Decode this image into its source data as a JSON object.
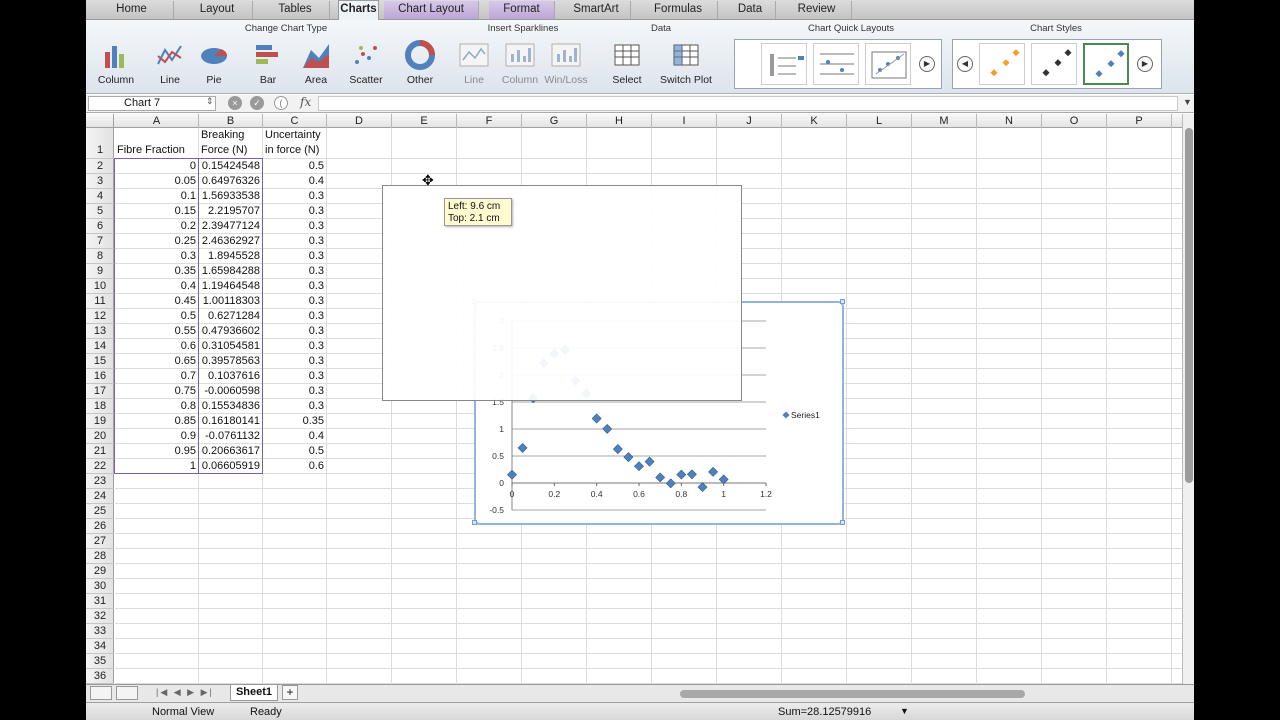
{
  "tabs": [
    {
      "label": "Home",
      "style": "normal"
    },
    {
      "label": "Layout",
      "style": "normal"
    },
    {
      "label": "Tables",
      "style": "normal"
    },
    {
      "label": "Charts",
      "style": "active"
    },
    {
      "label": "Chart Layout",
      "style": "purple"
    },
    {
      "label": "Format",
      "style": "purple"
    },
    {
      "label": "SmartArt",
      "style": "normal"
    },
    {
      "label": "Formulas",
      "style": "normal"
    },
    {
      "label": "Data",
      "style": "normal"
    },
    {
      "label": "Review",
      "style": "normal"
    }
  ],
  "ribbon": {
    "group_chart_type": "Change Chart Type",
    "group_sparklines": "Insert Sparklines",
    "group_data": "Data",
    "group_quick_layouts": "Chart Quick Layouts",
    "group_styles": "Chart Styles",
    "chart_types": [
      "Column",
      "Line",
      "Pie",
      "Bar",
      "Area",
      "Scatter",
      "Other"
    ],
    "sparklines": [
      "Line",
      "Column",
      "Win/Loss"
    ],
    "data_buttons": [
      "Select",
      "Switch Plot"
    ]
  },
  "formula_bar": {
    "name_box": "Chart 7",
    "fx": "fx",
    "value": ""
  },
  "columns": [
    "A",
    "B",
    "C",
    "D",
    "E",
    "F",
    "G",
    "H",
    "I",
    "J",
    "K",
    "L",
    "M",
    "N",
    "O",
    "P"
  ],
  "rows": [
    "1",
    "2",
    "3",
    "4",
    "5",
    "6",
    "7",
    "8",
    "9",
    "10",
    "11",
    "12",
    "13",
    "14",
    "15",
    "16",
    "17",
    "18",
    "19",
    "20",
    "21",
    "22",
    "23",
    "24",
    "25",
    "26",
    "27",
    "28",
    "29",
    "30",
    "31",
    "32",
    "33",
    "34",
    "35",
    "36"
  ],
  "headers": {
    "a1": "Fibre Fraction",
    "b1_line1": "Breaking",
    "b1_line2": "Force (N)",
    "c1_line1": "Uncertainty",
    "c1_line2": "in force (N)"
  },
  "table": [
    [
      "0",
      "0.15424548",
      "0.5"
    ],
    [
      "0.05",
      "0.64976326",
      "0.4"
    ],
    [
      "0.1",
      "1.56933538",
      "0.3"
    ],
    [
      "0.15",
      "2.2195707",
      "0.3"
    ],
    [
      "0.2",
      "2.39477124",
      "0.3"
    ],
    [
      "0.25",
      "2.46362927",
      "0.3"
    ],
    [
      "0.3",
      "1.8945528",
      "0.3"
    ],
    [
      "0.35",
      "1.65984288",
      "0.3"
    ],
    [
      "0.4",
      "1.19464548",
      "0.3"
    ],
    [
      "0.45",
      "1.00118303",
      "0.3"
    ],
    [
      "0.5",
      "0.6271284",
      "0.3"
    ],
    [
      "0.55",
      "0.47936602",
      "0.3"
    ],
    [
      "0.6",
      "0.31054581",
      "0.3"
    ],
    [
      "0.65",
      "0.39578563",
      "0.3"
    ],
    [
      "0.7",
      "0.1037616",
      "0.3"
    ],
    [
      "0.75",
      "-0.0060598",
      "0.3"
    ],
    [
      "0.8",
      "0.15534836",
      "0.3"
    ],
    [
      "0.85",
      "0.16180141",
      "0.35"
    ],
    [
      "0.9",
      "-0.0761132",
      "0.4"
    ],
    [
      "0.95",
      "0.20663617",
      "0.5"
    ],
    [
      "1",
      "0.06605919",
      "0.6"
    ]
  ],
  "tooltip": {
    "left": "Left: 9.6 cm",
    "top": "Top: 2.1 cm"
  },
  "sheet_tab": "Sheet1",
  "status": {
    "view": "Normal View",
    "state": "Ready",
    "sum": "Sum=28.12579916"
  },
  "colors": {
    "accent": "#4f81bd",
    "chart_border": "#8fb5de",
    "selection": "#7a5ea8"
  },
  "chart_data": {
    "type": "scatter",
    "series": [
      {
        "name": "Series1",
        "x": [
          0,
          0.05,
          0.1,
          0.15,
          0.2,
          0.25,
          0.3,
          0.35,
          0.4,
          0.45,
          0.5,
          0.55,
          0.6,
          0.65,
          0.7,
          0.75,
          0.8,
          0.85,
          0.9,
          0.95,
          1
        ],
        "y": [
          0.15424548,
          0.64976326,
          1.56933538,
          2.2195707,
          2.39477124,
          2.46362927,
          1.8945528,
          1.65984288,
          1.19464548,
          1.00118303,
          0.6271284,
          0.47936602,
          0.31054581,
          0.39578563,
          0.1037616,
          -0.0060598,
          0.15534836,
          0.16180141,
          -0.0761132,
          0.20663617,
          0.06605919
        ]
      }
    ],
    "xticks": [
      "0",
      "0.2",
      "0.4",
      "0.6",
      "0.8",
      "1",
      "1.2"
    ],
    "yticks": [
      "-0.5",
      "0",
      "0.5",
      "1",
      "1.5",
      "2",
      "2.5",
      "3"
    ],
    "xlim": [
      0,
      1.2
    ],
    "ylim": [
      -0.5,
      3
    ],
    "grid": "horizontal",
    "legend": "right"
  }
}
